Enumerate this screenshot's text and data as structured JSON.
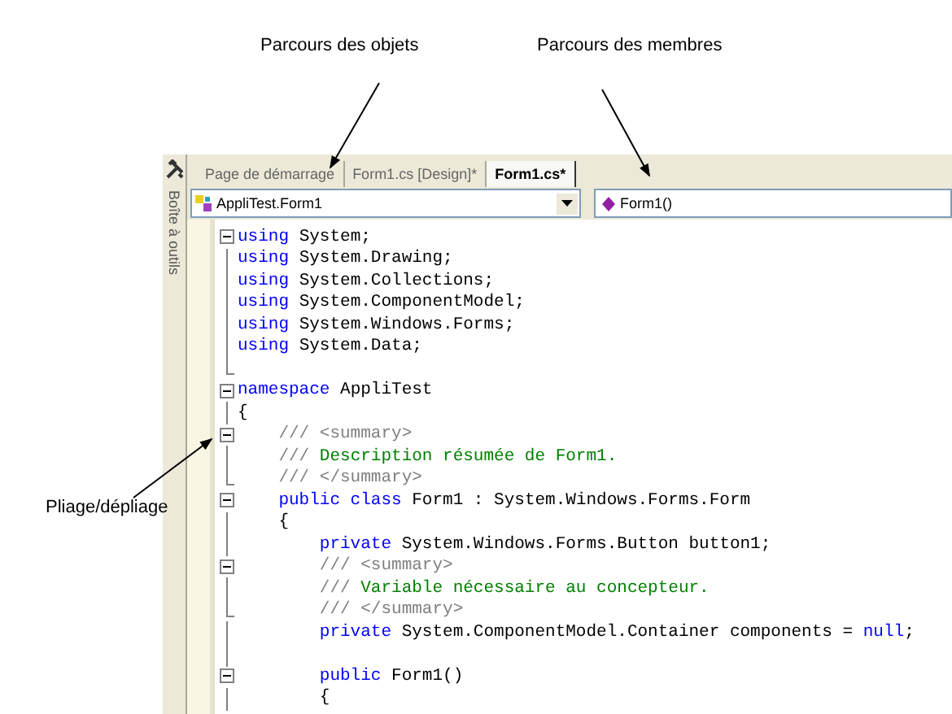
{
  "callouts": [
    {
      "label": "Parcours des objets",
      "kind": "objects"
    },
    {
      "label": "Parcours des membres",
      "kind": "members"
    },
    {
      "label": "Pliage/dépliage",
      "kind": "folding"
    }
  ],
  "toolbox": {
    "label": "Boîte à outils"
  },
  "tabs": [
    {
      "label": "Page de démarrage",
      "selected": false
    },
    {
      "label": "Form1.cs [Design]*",
      "selected": false
    },
    {
      "label": "Form1.cs*",
      "selected": true
    }
  ],
  "object_dropdown": {
    "value": "AppliTest.Form1"
  },
  "member_dropdown": {
    "value": "Form1()"
  },
  "code_lines": [
    {
      "kind": "fold-start",
      "tokens": [
        {
          "kind": "keyword",
          "text": "using"
        },
        {
          "kind": "plain",
          "text": " System;"
        }
      ]
    },
    {
      "kind": "fold-body",
      "tokens": [
        {
          "kind": "keyword",
          "text": "using"
        },
        {
          "kind": "plain",
          "text": " System.Drawing;"
        }
      ]
    },
    {
      "kind": "fold-body",
      "tokens": [
        {
          "kind": "keyword",
          "text": "using"
        },
        {
          "kind": "plain",
          "text": " System.Collections;"
        }
      ]
    },
    {
      "kind": "fold-body",
      "tokens": [
        {
          "kind": "keyword",
          "text": "using"
        },
        {
          "kind": "plain",
          "text": " System.ComponentModel;"
        }
      ]
    },
    {
      "kind": "fold-body",
      "tokens": [
        {
          "kind": "keyword",
          "text": "using"
        },
        {
          "kind": "plain",
          "text": " System.Windows.Forms;"
        }
      ]
    },
    {
      "kind": "fold-body",
      "tokens": [
        {
          "kind": "keyword",
          "text": "using"
        },
        {
          "kind": "plain",
          "text": " System.Data;"
        }
      ]
    },
    {
      "kind": "fold-end"
    },
    {
      "kind": "fold-start",
      "tokens": [
        {
          "kind": "keyword",
          "text": "namespace"
        },
        {
          "kind": "plain",
          "text": " AppliTest"
        }
      ]
    },
    {
      "kind": "fold-body",
      "tokens": [
        {
          "kind": "plain",
          "text": "{"
        }
      ]
    },
    {
      "kind": "fold-start",
      "tokens": [
        {
          "kind": "doc",
          "text": "    /// <summary>"
        }
      ]
    },
    {
      "kind": "fold-body",
      "tokens": [
        {
          "kind": "doc",
          "text": "    ///"
        },
        {
          "kind": "comment",
          "text": " Description résumée de Form1."
        }
      ]
    },
    {
      "kind": "fold-end",
      "tokens": [
        {
          "kind": "doc",
          "text": "    /// </summary>"
        }
      ]
    },
    {
      "kind": "fold-start",
      "tokens": [
        {
          "kind": "keyword",
          "text": "    public class"
        },
        {
          "kind": "plain",
          "text": " Form1 : System.Windows.Forms.Form"
        }
      ]
    },
    {
      "kind": "fold-body",
      "tokens": [
        {
          "kind": "plain",
          "text": "    {"
        }
      ]
    },
    {
      "kind": "fold-body",
      "tokens": [
        {
          "kind": "keyword",
          "text": "        private"
        },
        {
          "kind": "plain",
          "text": " System.Windows.Forms.Button button1;"
        }
      ]
    },
    {
      "kind": "fold-start",
      "tokens": [
        {
          "kind": "doc",
          "text": "        /// <summary>"
        }
      ]
    },
    {
      "kind": "fold-body",
      "tokens": [
        {
          "kind": "doc",
          "text": "        ///"
        },
        {
          "kind": "comment",
          "text": " Variable nécessaire au concepteur."
        }
      ]
    },
    {
      "kind": "fold-end",
      "tokens": [
        {
          "kind": "doc",
          "text": "        /// </summary>"
        }
      ]
    },
    {
      "kind": "fold-body",
      "tokens": [
        {
          "kind": "keyword",
          "text": "        private"
        },
        {
          "kind": "plain",
          "text": " System.ComponentModel.Container components = "
        },
        {
          "kind": "keyword",
          "text": "null"
        },
        {
          "kind": "plain",
          "text": ";"
        }
      ]
    },
    {
      "kind": "fold-body"
    },
    {
      "kind": "fold-start",
      "tokens": [
        {
          "kind": "keyword",
          "text": "        public"
        },
        {
          "kind": "plain",
          "text": " Form1()"
        }
      ]
    },
    {
      "kind": "fold-body",
      "tokens": [
        {
          "kind": "plain",
          "text": "        {"
        }
      ]
    }
  ]
}
